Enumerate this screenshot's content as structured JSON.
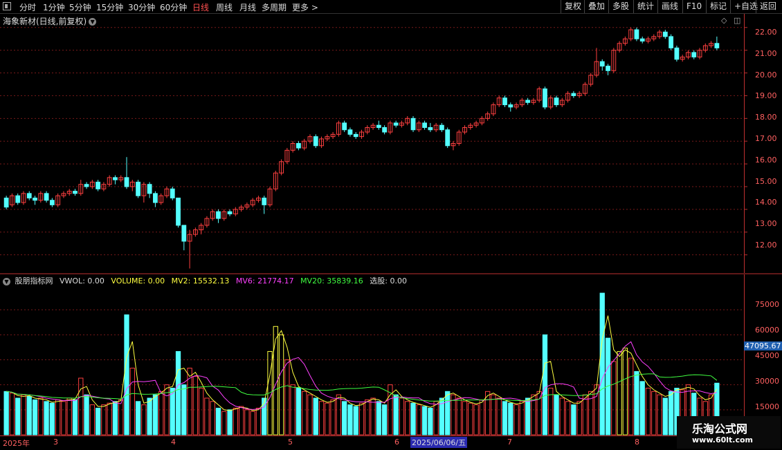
{
  "toolbar": {
    "periods": [
      "分时",
      "1分钟",
      "5分钟",
      "15分钟",
      "30分钟",
      "60分钟",
      "日线",
      "周线",
      "月线",
      "多周期",
      "更多 >"
    ],
    "active": "日线",
    "right": [
      "复权",
      "叠加",
      "多股",
      "统计",
      "画线",
      "F10",
      "标记",
      "+自选",
      "返回"
    ]
  },
  "header": {
    "title": "海象新材(日线,前复权)"
  },
  "indicator": {
    "name": "股朋指标网",
    "vwol": "VWOL: 0.00",
    "volume": "VOLUME: 0.00",
    "mv2": "MV2: 15532.13",
    "mv6": "MV6: 21774.17",
    "mv20": "MV20: 35839.16",
    "pick": "选股: 0.00"
  },
  "price_axis": [
    "22.00",
    "21.00",
    "20.00",
    "19.00",
    "18.00",
    "17.00",
    "16.00",
    "15.00",
    "14.00",
    "13.00",
    "12.00"
  ],
  "vol_axis": [
    "75000",
    "60000",
    "45000",
    "30000",
    "15000"
  ],
  "vol_highlight": "47095.67",
  "date_axis": {
    "labels": [
      "2025年",
      "3",
      "4",
      "5",
      "6",
      "7",
      "8"
    ],
    "highlight": "2025/06/06/五"
  },
  "watermark": {
    "line1": "乐淘公式网",
    "line2": "www.60lt.com"
  },
  "colors": {
    "up": "#ff4040",
    "down": "#54ffff",
    "mv2": "#ffff40",
    "mv6": "#ff40ff",
    "mv20": "#40ff40",
    "grid": "#7a1a1a"
  },
  "chart_data": {
    "type": "candlestick",
    "ylim": [
      11.2,
      22.6
    ],
    "candles": [
      [
        14.5,
        14.1,
        14.6,
        14.0
      ],
      [
        14.2,
        14.6,
        14.7,
        14.1
      ],
      [
        14.6,
        14.3,
        14.7,
        14.2
      ],
      [
        14.3,
        14.7,
        14.8,
        14.2
      ],
      [
        14.7,
        14.5,
        14.8,
        14.4
      ],
      [
        14.5,
        14.4,
        14.6,
        14.2
      ],
      [
        14.4,
        14.7,
        14.8,
        14.3
      ],
      [
        14.7,
        14.4,
        14.8,
        14.3
      ],
      [
        14.4,
        14.2,
        14.5,
        14.1
      ],
      [
        14.2,
        14.6,
        14.7,
        14.1
      ],
      [
        14.6,
        14.7,
        14.8,
        14.5
      ],
      [
        14.7,
        14.8,
        14.9,
        14.6
      ],
      [
        14.8,
        14.7,
        14.9,
        14.6
      ],
      [
        14.7,
        15.1,
        15.3,
        14.6
      ],
      [
        15.1,
        15.0,
        15.2,
        14.9
      ],
      [
        15.0,
        15.2,
        15.3,
        14.9
      ],
      [
        15.2,
        14.9,
        15.3,
        14.8
      ],
      [
        14.9,
        15.1,
        15.2,
        14.8
      ],
      [
        15.1,
        15.4,
        15.5,
        15.0
      ],
      [
        15.4,
        15.3,
        15.5,
        15.1
      ],
      [
        15.3,
        15.4,
        15.5,
        15.2
      ],
      [
        15.4,
        15.0,
        16.3,
        14.9
      ],
      [
        15.0,
        15.2,
        15.3,
        14.8
      ],
      [
        15.2,
        14.6,
        15.3,
        14.5
      ],
      [
        14.6,
        15.1,
        15.2,
        14.3
      ],
      [
        15.1,
        14.7,
        15.2,
        14.5
      ],
      [
        14.7,
        14.3,
        14.8,
        14.1
      ],
      [
        14.3,
        14.6,
        14.7,
        14.2
      ],
      [
        14.6,
        14.9,
        15.0,
        14.5
      ],
      [
        14.9,
        14.5,
        15.0,
        14.4
      ],
      [
        14.5,
        13.3,
        14.5,
        13.2
      ],
      [
        13.3,
        12.6,
        12.9,
        12.2
      ],
      [
        12.6,
        12.9,
        13.1,
        11.4
      ],
      [
        12.9,
        13.1,
        13.2,
        12.8
      ],
      [
        13.1,
        13.3,
        13.4,
        12.9
      ],
      [
        13.3,
        13.6,
        13.7,
        13.2
      ],
      [
        13.6,
        13.9,
        14.0,
        13.5
      ],
      [
        13.9,
        13.6,
        14.0,
        13.4
      ],
      [
        13.6,
        13.9,
        14.0,
        13.5
      ],
      [
        13.9,
        13.8,
        14.0,
        13.7
      ],
      [
        13.8,
        14.0,
        14.1,
        13.7
      ],
      [
        14.0,
        14.1,
        14.2,
        13.9
      ],
      [
        14.1,
        14.2,
        14.3,
        14.0
      ],
      [
        14.2,
        14.4,
        14.5,
        14.1
      ],
      [
        14.4,
        14.5,
        14.6,
        14.3
      ],
      [
        14.5,
        14.2,
        14.6,
        13.8
      ],
      [
        14.2,
        14.9,
        15.0,
        14.1
      ],
      [
        14.9,
        15.6,
        15.7,
        14.8
      ],
      [
        15.6,
        16.1,
        16.2,
        15.5
      ],
      [
        16.1,
        16.6,
        16.7,
        16.0
      ],
      [
        16.6,
        16.9,
        17.0,
        16.5
      ],
      [
        16.9,
        16.7,
        17.0,
        16.6
      ],
      [
        16.7,
        17.0,
        17.1,
        16.6
      ],
      [
        17.0,
        17.2,
        17.3,
        16.9
      ],
      [
        17.2,
        16.8,
        17.3,
        16.7
      ],
      [
        16.8,
        17.1,
        17.2,
        16.7
      ],
      [
        17.1,
        17.2,
        17.3,
        17.0
      ],
      [
        17.2,
        17.3,
        17.4,
        17.1
      ],
      [
        17.3,
        17.8,
        17.9,
        17.2
      ],
      [
        17.8,
        17.5,
        17.9,
        17.4
      ],
      [
        17.5,
        17.3,
        17.6,
        17.2
      ],
      [
        17.3,
        17.2,
        17.4,
        17.1
      ],
      [
        17.2,
        17.4,
        17.5,
        17.1
      ],
      [
        17.4,
        17.6,
        17.7,
        17.3
      ],
      [
        17.6,
        17.7,
        17.8,
        17.5
      ],
      [
        17.7,
        17.6,
        17.9,
        17.5
      ],
      [
        17.6,
        17.4,
        17.7,
        17.3
      ],
      [
        17.4,
        17.8,
        17.9,
        17.3
      ],
      [
        17.8,
        17.7,
        17.9,
        17.6
      ],
      [
        17.7,
        17.8,
        17.9,
        17.6
      ],
      [
        17.8,
        18.0,
        18.1,
        17.7
      ],
      [
        18.0,
        17.5,
        18.1,
        17.4
      ],
      [
        17.5,
        17.8,
        17.9,
        17.4
      ],
      [
        17.8,
        17.6,
        17.9,
        17.5
      ],
      [
        17.6,
        17.5,
        17.8,
        17.4
      ],
      [
        17.5,
        17.7,
        17.8,
        17.4
      ],
      [
        17.7,
        17.5,
        17.8,
        17.4
      ],
      [
        17.5,
        16.8,
        17.6,
        16.7
      ],
      [
        16.8,
        16.9,
        17.0,
        16.6
      ],
      [
        16.9,
        17.4,
        17.5,
        16.8
      ],
      [
        17.4,
        17.6,
        17.7,
        17.3
      ],
      [
        17.6,
        17.7,
        17.8,
        17.5
      ],
      [
        17.7,
        17.8,
        17.9,
        17.6
      ],
      [
        17.8,
        18.0,
        18.1,
        17.7
      ],
      [
        18.0,
        18.2,
        18.3,
        17.9
      ],
      [
        18.2,
        18.6,
        18.7,
        18.1
      ],
      [
        18.6,
        18.9,
        19.0,
        18.5
      ],
      [
        18.9,
        18.6,
        19.0,
        18.5
      ],
      [
        18.6,
        18.5,
        18.7,
        18.3
      ],
      [
        18.5,
        18.6,
        18.7,
        18.4
      ],
      [
        18.6,
        18.8,
        18.9,
        18.5
      ],
      [
        18.8,
        18.7,
        18.9,
        18.6
      ],
      [
        18.7,
        18.8,
        18.9,
        18.6
      ],
      [
        18.8,
        19.3,
        19.4,
        18.7
      ],
      [
        19.3,
        18.5,
        19.4,
        18.4
      ],
      [
        18.5,
        18.9,
        19.0,
        18.4
      ],
      [
        18.9,
        18.6,
        19.0,
        18.5
      ],
      [
        18.6,
        18.8,
        18.9,
        18.5
      ],
      [
        18.8,
        19.1,
        19.2,
        18.7
      ],
      [
        19.1,
        19.0,
        19.2,
        18.9
      ],
      [
        19.0,
        19.1,
        19.2,
        18.9
      ],
      [
        19.1,
        19.5,
        19.6,
        19.0
      ],
      [
        19.5,
        19.9,
        20.0,
        19.4
      ],
      [
        19.9,
        20.5,
        21.1,
        19.8
      ],
      [
        20.5,
        20.3,
        20.6,
        20.1
      ],
      [
        20.3,
        20.1,
        20.4,
        19.9
      ],
      [
        20.1,
        21.0,
        21.1,
        20.0
      ],
      [
        21.0,
        21.3,
        21.4,
        20.9
      ],
      [
        21.3,
        21.5,
        21.6,
        21.2
      ],
      [
        21.5,
        21.9,
        22.0,
        21.4
      ],
      [
        21.9,
        21.5,
        22.0,
        21.4
      ],
      [
        21.5,
        21.4,
        21.6,
        21.3
      ],
      [
        21.4,
        21.5,
        21.6,
        21.3
      ],
      [
        21.5,
        21.6,
        21.7,
        21.4
      ],
      [
        21.6,
        21.8,
        21.9,
        21.5
      ],
      [
        21.8,
        21.6,
        21.9,
        21.5
      ],
      [
        21.6,
        21.1,
        21.7,
        21.0
      ],
      [
        21.1,
        20.6,
        21.2,
        20.5
      ],
      [
        20.6,
        20.7,
        20.8,
        20.5
      ],
      [
        20.7,
        20.9,
        21.0,
        20.6
      ],
      [
        20.9,
        20.7,
        21.0,
        20.6
      ],
      [
        20.7,
        21.0,
        21.1,
        20.6
      ],
      [
        21.0,
        21.2,
        21.3,
        20.9
      ],
      [
        21.2,
        21.3,
        21.4,
        21.1
      ],
      [
        21.3,
        21.1,
        21.6,
        21.0
      ]
    ],
    "volumes": [
      26000,
      25000,
      22000,
      24000,
      23000,
      21000,
      22000,
      20000,
      19000,
      21000,
      20000,
      22000,
      21000,
      34000,
      24000,
      18000,
      16000,
      18000,
      19000,
      20000,
      21000,
      72000,
      40000,
      20000,
      18000,
      22000,
      24000,
      26000,
      30000,
      28000,
      50000,
      30000,
      40000,
      35000,
      28000,
      22000,
      20000,
      16000,
      14000,
      15000,
      16000,
      17000,
      15000,
      14000,
      16000,
      22000,
      50000,
      65000,
      60000,
      45000,
      30000,
      28000,
      26000,
      24000,
      22000,
      20000,
      19000,
      21000,
      24000,
      20000,
      18000,
      17000,
      19000,
      21000,
      22000,
      20000,
      18000,
      30000,
      24000,
      22000,
      20000,
      19000,
      18000,
      17000,
      16000,
      20000,
      22000,
      26000,
      24000,
      22000,
      20000,
      19000,
      18000,
      21000,
      26000,
      24000,
      22000,
      20000,
      19000,
      18000,
      20000,
      22000,
      24000,
      26000,
      60000,
      28000,
      24000,
      22000,
      20000,
      18000,
      20000,
      24000,
      26000,
      30000,
      85000,
      58000,
      44000,
      50000,
      52000,
      46000,
      38000,
      32000,
      28000,
      26000,
      24000,
      22000,
      26000,
      28000,
      27000,
      30000,
      25000,
      22000,
      20000,
      24000,
      31000
    ],
    "vol_ylim": [
      0,
      90000
    ],
    "series": [
      {
        "name": "MV2"
      },
      {
        "name": "MV6"
      },
      {
        "name": "MV20"
      }
    ]
  }
}
